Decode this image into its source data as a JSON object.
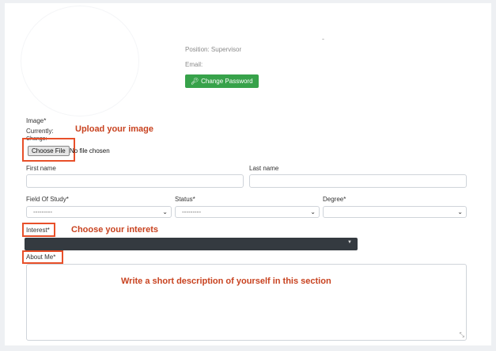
{
  "profile": {
    "dash": "-",
    "position_text": "Position: Supervisor",
    "email_label": "Email:",
    "change_password_label": "Change Password"
  },
  "image_section": {
    "label": "Image*",
    "currently_label": "Currently:",
    "change_label": "Change:",
    "choose_file_label": "Choose File",
    "no_file_text": "No file chosen",
    "annotation": "Upload your image"
  },
  "name_fields": {
    "first_name_label": "First name",
    "first_name_value": "",
    "last_name_label": "Last name",
    "last_name_value": ""
  },
  "selects": {
    "field_of_study": {
      "label": "Field Of Study*",
      "value": "---------"
    },
    "status": {
      "label": "Status*",
      "value": "---------"
    },
    "degree": {
      "label": "Degree*",
      "value": ""
    }
  },
  "interest": {
    "label": "Interest*",
    "annotation": "Choose your interets"
  },
  "about": {
    "label": "About Me*",
    "annotation": "Write a short description of yourself in this section"
  },
  "colors": {
    "annotation": "#c8421f",
    "highlight_box": "#e8502a",
    "button_green": "#37a24a",
    "dark_select": "#343a40"
  }
}
